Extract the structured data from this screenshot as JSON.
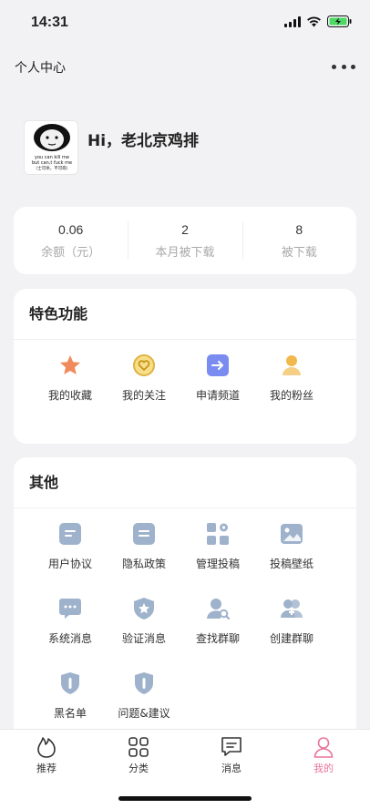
{
  "status_bar": {
    "time": "14:31"
  },
  "header": {
    "title": "个人中心"
  },
  "profile": {
    "greeting": "Hi，老北京鸡排",
    "avatar_caption_line1": "you can kill me",
    "avatar_caption_line2": "but can,t fuck me",
    "avatar_caption_line3": "（士可杀，不可辱）"
  },
  "stats": [
    {
      "value": "0.06",
      "label": "余额（元）"
    },
    {
      "value": "2",
      "label": "本月被下载"
    },
    {
      "value": "8",
      "label": "被下载"
    }
  ],
  "features": {
    "title": "特色功能",
    "items": [
      {
        "label": "我的收藏",
        "icon": "star-icon",
        "color": "#f08a5d"
      },
      {
        "label": "我的关注",
        "icon": "heart-coin-icon",
        "color": "#e0b341"
      },
      {
        "label": "申请频道",
        "icon": "arrow-right-box-icon",
        "color": "#7b8cf0"
      },
      {
        "label": "我的粉丝",
        "icon": "user-icon",
        "color": "#f2b84b"
      }
    ]
  },
  "other": {
    "title": "其他",
    "items": [
      {
        "label": "用户协议",
        "icon": "document-icon"
      },
      {
        "label": "隐私政策",
        "icon": "document-icon"
      },
      {
        "label": "管理投稿",
        "icon": "grid-gear-icon"
      },
      {
        "label": "投稿壁纸",
        "icon": "image-icon"
      },
      {
        "label": "系统消息",
        "icon": "message-icon"
      },
      {
        "label": "验证消息",
        "icon": "shield-star-icon"
      },
      {
        "label": "查找群聊",
        "icon": "user-search-icon"
      },
      {
        "label": "创建群聊",
        "icon": "group-add-icon"
      },
      {
        "label": "黑名单",
        "icon": "block-icon"
      },
      {
        "label": "问题&建议",
        "icon": "feedback-icon"
      }
    ],
    "icon_color": "#9fb2cc"
  },
  "tabbar": {
    "items": [
      {
        "label": "推荐",
        "icon": "flame-icon"
      },
      {
        "label": "分类",
        "icon": "category-icon"
      },
      {
        "label": "消息",
        "icon": "chat-icon"
      },
      {
        "label": "我的",
        "icon": "person-icon",
        "active": true
      }
    ],
    "active_color": "#e8749a"
  }
}
